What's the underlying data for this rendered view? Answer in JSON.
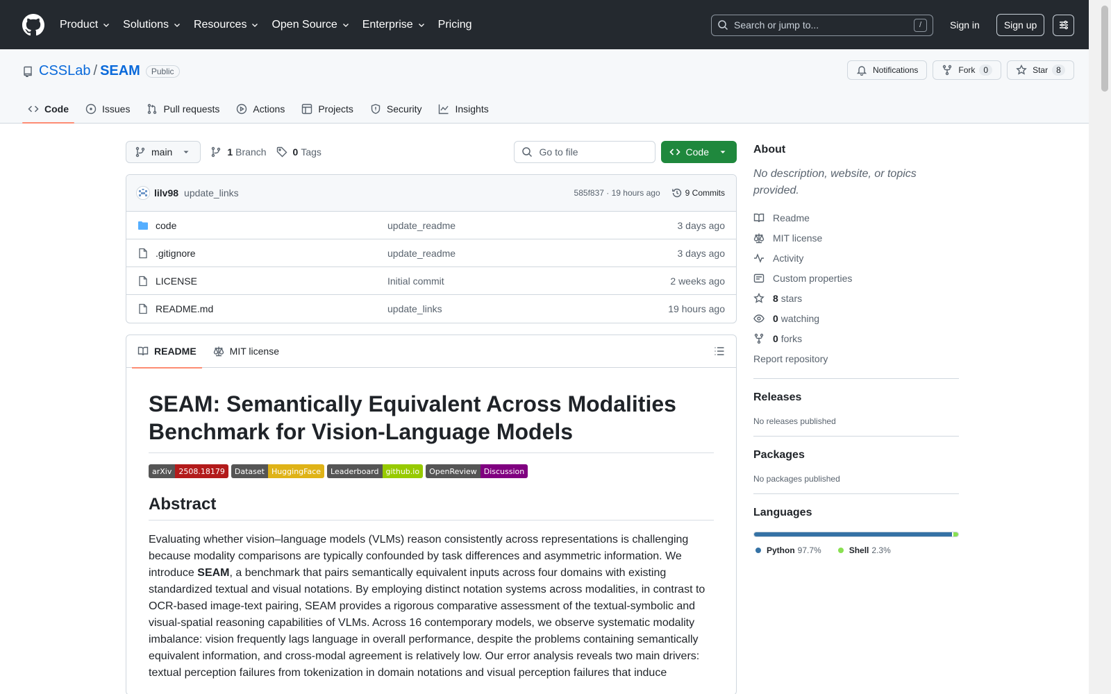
{
  "header": {
    "nav": [
      "Product",
      "Solutions",
      "Resources",
      "Open Source",
      "Enterprise",
      "Pricing"
    ],
    "search_placeholder": "Search or jump to...",
    "search_shortcut": "/",
    "sign_in": "Sign in",
    "sign_up": "Sign up"
  },
  "repo": {
    "owner": "CSSLab",
    "separator": "/",
    "name": "SEAM",
    "visibility": "Public",
    "notifications_label": "Notifications",
    "fork_label": "Fork",
    "fork_count": "0",
    "star_label": "Star",
    "star_count": "8",
    "tabs": [
      "Code",
      "Issues",
      "Pull requests",
      "Actions",
      "Projects",
      "Security",
      "Insights"
    ]
  },
  "toolbar": {
    "branch": "main",
    "branch_count": "1",
    "branch_label": "Branch",
    "tag_count": "0",
    "tag_label": "Tags",
    "goto_placeholder": "Go to file",
    "code_button": "Code"
  },
  "latest_commit": {
    "author": "lilv98",
    "message": "update_links",
    "sha_time": "585f837 · 19 hours ago",
    "commits_label": "9 Commits"
  },
  "files": [
    {
      "name": "code",
      "type": "dir",
      "commit": "update_readme",
      "date": "3 days ago"
    },
    {
      "name": ".gitignore",
      "type": "file",
      "commit": "update_readme",
      "date": "3 days ago"
    },
    {
      "name": "LICENSE",
      "type": "file",
      "commit": "Initial commit",
      "date": "2 weeks ago"
    },
    {
      "name": "README.md",
      "type": "file",
      "commit": "update_links",
      "date": "19 hours ago"
    }
  ],
  "readme": {
    "tabs": [
      "README",
      "MIT license"
    ],
    "title": "SEAM: Semantically Equivalent Across Modalities Benchmark for Vision-Language Models",
    "badges": [
      {
        "label": "arXiv",
        "value": "2508.18179",
        "color": "#b31b1b"
      },
      {
        "label": "Dataset",
        "value": "HuggingFace",
        "color": "#dfb317"
      },
      {
        "label": "Leaderboard",
        "value": "github.io",
        "color": "#97ca00"
      },
      {
        "label": "OpenReview",
        "value": "Discussion",
        "color": "#800080"
      }
    ],
    "abstract_heading": "Abstract",
    "abstract_pre": "Evaluating whether vision–language models (VLMs) reason consistently across representations is challenging because modality comparisons are typically confounded by task differences and asymmetric information. We introduce ",
    "abstract_bold": "SEAM",
    "abstract_post": ", a benchmark that pairs semantically equivalent inputs across four domains with existing standardized textual and visual notations. By employing distinct notation systems across modalities, in contrast to OCR-based image-text pairing, SEAM provides a rigorous comparative assessment of the textual-symbolic and visual-spatial reasoning capabilities of VLMs. Across 16 contemporary models, we observe systematic modality imbalance: vision frequently lags language in overall performance, despite the problems containing semantically equivalent information, and cross-modal agreement is relatively low. Our error analysis reveals two main drivers: textual perception failures from tokenization in domain notations and visual perception failures that induce"
  },
  "about": {
    "heading": "About",
    "description": "No description, website, or topics provided.",
    "items": [
      {
        "icon": "book-icon",
        "text": "Readme",
        "bold": ""
      },
      {
        "icon": "law-icon",
        "text": "MIT license",
        "bold": ""
      },
      {
        "icon": "pulse-icon",
        "text": "Activity",
        "bold": ""
      },
      {
        "icon": "note-icon",
        "text": "Custom properties",
        "bold": ""
      },
      {
        "icon": "star-icon",
        "text": "stars",
        "bold": "8"
      },
      {
        "icon": "eye-icon",
        "text": "watching",
        "bold": "0"
      },
      {
        "icon": "fork-icon",
        "text": "forks",
        "bold": "0"
      }
    ],
    "report": "Report repository"
  },
  "releases": {
    "heading": "Releases",
    "note": "No releases published"
  },
  "packages": {
    "heading": "Packages",
    "note": "No packages published"
  },
  "languages": {
    "heading": "Languages",
    "list": [
      {
        "name": "Python",
        "pct": "97.7%",
        "value": 97.7,
        "color": "#3572A5"
      },
      {
        "name": "Shell",
        "pct": "2.3%",
        "value": 2.3,
        "color": "#89e051"
      }
    ]
  }
}
